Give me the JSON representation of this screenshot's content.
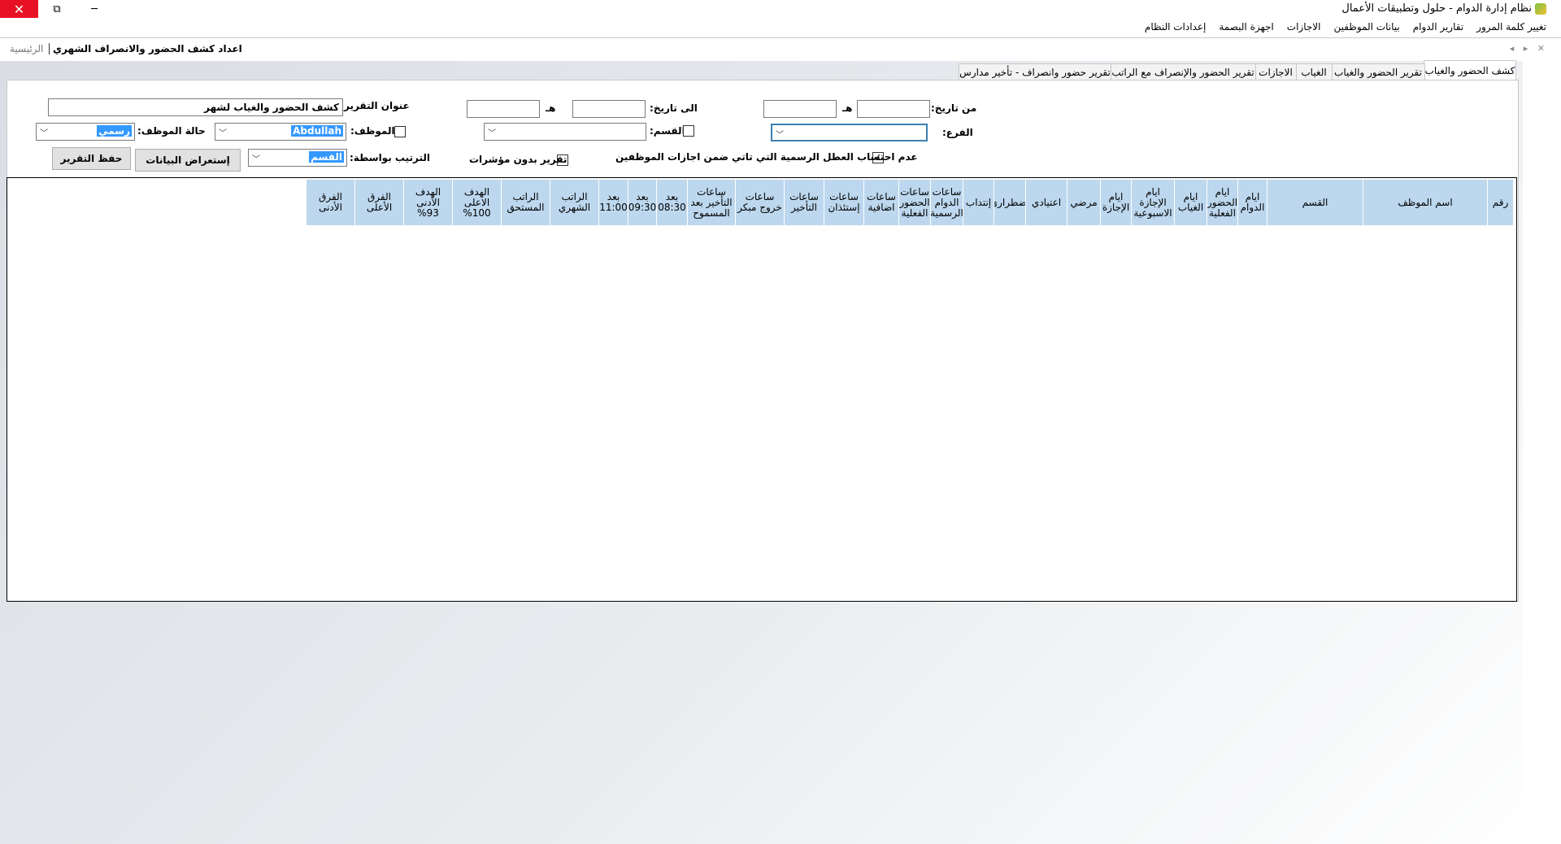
{
  "window": {
    "title": "نظام إدارة الدوام - حلول وتطبيقات الأعمال",
    "close_glyph": "✕",
    "restore_glyph": "⧉",
    "minimize_glyph": "─"
  },
  "menu": [
    "إعدادات النظام",
    "اجهزة البصمة",
    "الاجازات",
    "بيانات الموظفين",
    "تقارير الدوام",
    "تغيير كلمة المرور"
  ],
  "doc_tabs": {
    "active": "اعداد كشف الحضور والانصراف الشهري",
    "home": "الرئيسية",
    "arrows": "◂ ▸ ✕"
  },
  "report_tabs": [
    "كشف الحضور والغياب",
    "تقرير الحضور والغياب",
    "الغياب",
    "الاجازات",
    "تقرير الحضور والإنصراف مع الراتب",
    "تقرير حضور وانصراف - تأخير مدارس"
  ],
  "form": {
    "from_date_label": "من تاريخ:",
    "from_hijri_mark": "هـ",
    "from_date_value": "",
    "from_hijri_value": "",
    "to_date_label": "الى تاريخ:",
    "to_hijri_mark": "هـ",
    "to_date_value": "",
    "to_hijri_value": "",
    "report_title_label": "عنوان التقرير",
    "report_title_value": "كشف الحضور والغياب لشهر",
    "branch_label": "الفرع:",
    "branch_value": "",
    "section_label": "القسم:",
    "employee_label": "الموظف:",
    "employee_value": "Abdullah",
    "status_label": "حالة الموظف:",
    "status_value": "رسمي",
    "exclude_holidays_label": "عدم احتساب العطل الرسمية التي تاتي ضمن اجازات الموظفين",
    "exclude_holidays_checked": "✓",
    "no_indicators_label": "تقرير بدون مؤشرات",
    "sort_by_label": "الترتيب بواسطة:",
    "sort_by_value": "القسم",
    "show_data_button": "إستعراض البيانات",
    "save_report_button": "حفظ التقرير"
  },
  "table_headers": [
    "رقم",
    "اسم الموظف",
    "القسم",
    "ايام الدوام",
    "ايام الحضور الفعلية",
    "ايام الغياب",
    "ايام الإجازة الاسبوعية",
    "ايام الإجازة",
    "مرضي",
    "اعتيادي",
    "اضطراري",
    "إنتداب",
    "ساعات الدوام الرسمية",
    "ساعات الحضور الفعلية",
    "ساعات اضافية",
    "ساعات إستئذان",
    "ساعات التأخير",
    "ساعات خروج مبكر",
    "ساعات التأخير بعد المسموح",
    "بعد 08:30",
    "بعد 09:30",
    "بعد 11:00",
    "الراتب الشهري",
    "الراتب المستحق",
    "الهدف الاعلى 100%",
    "الهدف الأدنى 93%",
    "الفرق الأعلى",
    "الفرق الأدنى"
  ]
}
